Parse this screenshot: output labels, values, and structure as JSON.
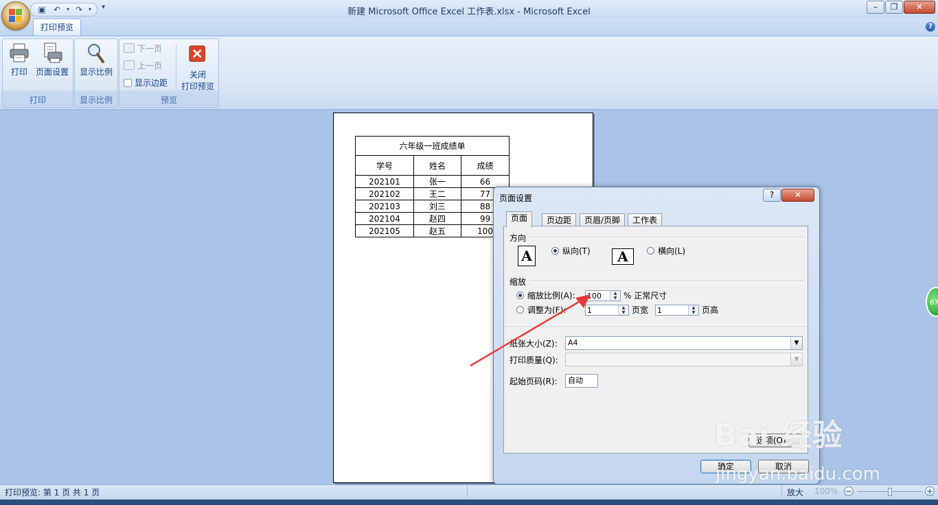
{
  "window": {
    "title": "新建 Microsoft Office Excel 工作表.xlsx - Microsoft Excel",
    "minimize": "–",
    "maximize": "❐",
    "close": "✕"
  },
  "ribbon": {
    "tab": "打印预览",
    "help": "?",
    "groups": {
      "print": {
        "label": "打印",
        "print_button": "打印",
        "page_setup_button": "页面设置"
      },
      "zoom": {
        "label": "显示比例",
        "zoom_button": "显示比例"
      },
      "preview": {
        "label": "预览",
        "next_page": "下一页",
        "prev_page": "上一页",
        "show_margins": "显示边距",
        "close_line1": "关闭",
        "close_line2": "打印预览"
      }
    }
  },
  "sheet": {
    "title": "六年级一班成绩单",
    "headers": [
      "学号",
      "姓名",
      "成绩"
    ],
    "rows": [
      [
        "202101",
        "张一",
        "66"
      ],
      [
        "202102",
        "王二",
        "77"
      ],
      [
        "202103",
        "刘三",
        "88"
      ],
      [
        "202104",
        "赵四",
        "99"
      ],
      [
        "202105",
        "赵五",
        "100"
      ]
    ]
  },
  "dialog": {
    "title": "页面设置",
    "help": "?",
    "close": "✕",
    "tabs": [
      "页面",
      "页边距",
      "页眉/页脚",
      "工作表"
    ],
    "orientation": {
      "label": "方向",
      "portrait": "纵向(T)",
      "landscape": "横向(L)",
      "icon_glyph": "A"
    },
    "scaling": {
      "label": "缩放",
      "adjust_to": "缩放比例(A):",
      "adjust_value": "100",
      "percent_suffix": "% 正常尺寸",
      "fit_to": "调整为(F):",
      "pages_wide_value": "1",
      "pages_wide_label": "页宽",
      "pages_tall_value": "1",
      "pages_tall_label": "页高"
    },
    "paper_size": {
      "label": "纸张大小(Z):",
      "value": "A4"
    },
    "print_quality": {
      "label": "打印质量(Q):",
      "value": ""
    },
    "first_page_number": {
      "label": "起始页码(R):",
      "value": "自动"
    },
    "buttons": {
      "options": "选项(O)...",
      "ok": "确定",
      "cancel": "取消"
    }
  },
  "status": {
    "text": "打印预览: 第 1 页  共 1 页",
    "zoom_label": "放大",
    "zoom_percent": "100%",
    "zoom_minus": "−",
    "zoom_plus": "+"
  },
  "overlay": {
    "side_badge": "67",
    "watermark": "Bai 经验",
    "watermark_sub": "jingyan.baidu.com"
  },
  "colors": {
    "ribbon_text": "#15428b",
    "workspace": "#a9c4e6",
    "arrow": "#e63b3b",
    "close_red": "#c24a2f"
  }
}
